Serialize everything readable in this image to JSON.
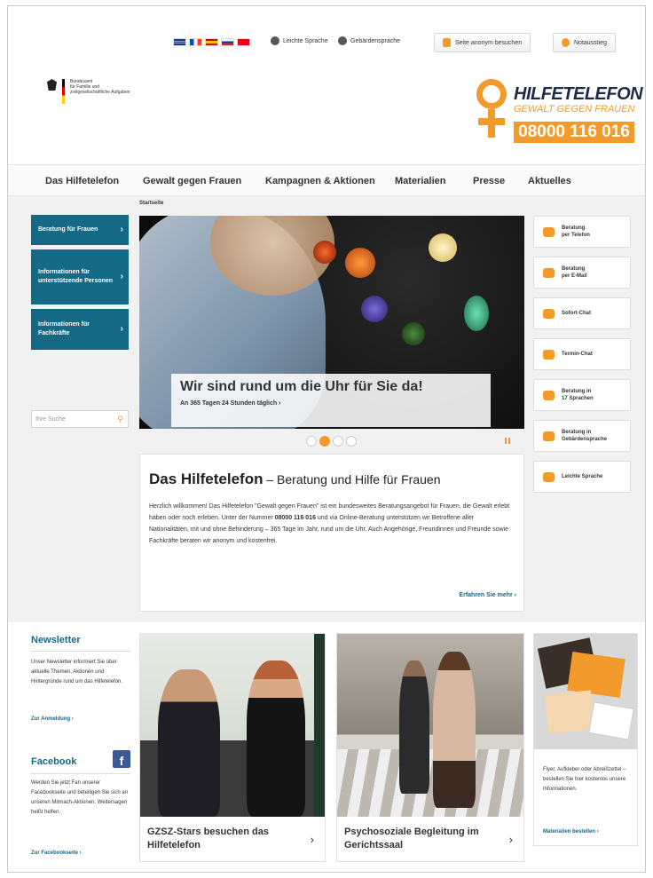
{
  "topbar": {
    "flags": [
      "uk",
      "fr",
      "es",
      "ru",
      "tr"
    ],
    "simple_language": "Leichte Sprache",
    "sign_language": "Gebärdensprache",
    "anonymous_btn": "Seite anonym besuchen",
    "emergency_btn": "Notausstieg"
  },
  "header": {
    "ministry_line1": "Bundesamt",
    "ministry_line2": "für Familie und",
    "ministry_line3": "zivilgesellschaftliche Aufgaben",
    "logo_title": "HILFETELEFON",
    "logo_subtitle": "GEWALT GEGEN FRAUEN",
    "logo_phone": "08000 116 016"
  },
  "nav": {
    "items": [
      "Das Hilfetelefon",
      "Gewalt gegen Frauen",
      "Kampagnen & Aktionen",
      "Materialien",
      "Presse",
      "Aktuelles"
    ]
  },
  "breadcrumb": "Startseite",
  "left_sidebar": {
    "buttons": [
      "Beratung für Frauen",
      "Informationen für unterstützende Personen",
      "Informationen für Fachkräfte"
    ],
    "search_placeholder": "Ihre Suche"
  },
  "hero": {
    "title": "Wir sind rund um die Uhr für Sie da!",
    "subtitle": "An 365 Tagen 24 Stunden täglich  ›"
  },
  "slider": {
    "count": 4,
    "active": 1
  },
  "intro": {
    "title_bold": "Das Hilfetelefon",
    "title_rest": " – Beratung und Hilfe für Frauen",
    "text_part1": "Herzlich willkommen! Das Hilfetelefon \"Gewalt gegen Frauen\" ist ein bundesweites Beratungsangebot für Frauen, die Gewalt erlebt haben oder noch erleben. Unter der Nummer ",
    "text_number": "08000 116 016",
    "text_part2": " und via Online-Beratung unterstützen wir Betroffene aller Nationalitäten, mit und ohne Behinderung – 365 Tage im Jahr, rund um die Uhr. Auch Angehörige, Freundinnen und Freunde sowie Fachkräfte beraten wir anonym und kostenfrei.",
    "more": "Erfahren Sie mehr  ›"
  },
  "right_sidebar": {
    "items": [
      {
        "label1": "Beratung",
        "label2": "per Telefon",
        "icon": "phone-icon"
      },
      {
        "label1": "Beratung",
        "label2": "per E-Mail",
        "icon": "mail-icon"
      },
      {
        "label1": "Sofort-Chat",
        "label2": "",
        "icon": "chat-person-icon"
      },
      {
        "label1": "Termin-Chat",
        "label2": "",
        "icon": "chat-bubble-icon"
      },
      {
        "label1": "Beratung in",
        "label2": "17 Sprachen",
        "icon": "languages-icon"
      },
      {
        "label1": "Beratung in",
        "label2": "Gebärdensprache",
        "icon": "sign-language-icon"
      },
      {
        "label1": "Leichte Sprache",
        "label2": "",
        "icon": "easy-language-icon"
      }
    ]
  },
  "newsletter": {
    "title": "Newsletter",
    "text": "Unser Newsletter informiert Sie über aktuelle Themen, Aktionen und Hintergründe rund um das Hilfetelefon.",
    "link": "Zur Anmeldung  ›"
  },
  "facebook": {
    "title": "Facebook",
    "icon_letter": "f",
    "text": "Werden Sie jetzt Fan unserer Facebookseite und beteiligen Sie sich an unseren Mitmach-Aktionen. Weitersagen heißt helfen.",
    "link": "Zur Facebookseite  ›"
  },
  "teasers": [
    {
      "caption": "GZSZ-Stars besuchen das Hilfetelefon",
      "chevron": "›"
    },
    {
      "caption": "Psychosoziale Begleitung im Gerichtssaal",
      "chevron": "›"
    }
  ],
  "materials": {
    "text": "Flyer, Aufkleber oder Abreißzettel – bestellen Sie hier kostenlos unsere Informationen.",
    "link": "Materialien bestellen  ›"
  },
  "colors": {
    "accent_orange": "#f39a2c",
    "brand_teal": "#146a84",
    "logo_navy": "#1f2a44",
    "facebook_blue": "#3b5998"
  }
}
